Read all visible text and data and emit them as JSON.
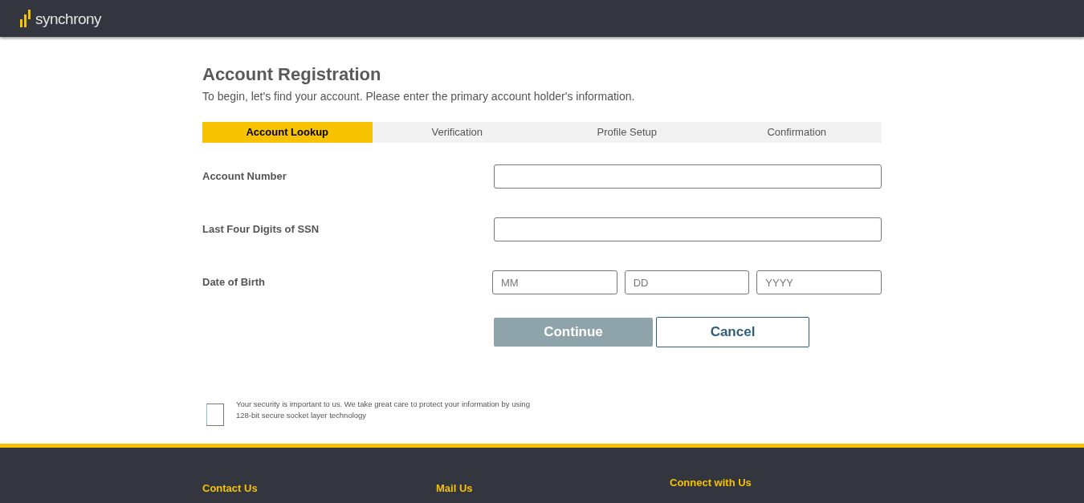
{
  "header": {
    "logo_text": "synchrony"
  },
  "page": {
    "title": "Account Registration",
    "subtitle": "To begin, let's find your account. Please enter the primary account holder's information."
  },
  "steps": [
    {
      "label": "Account Lookup",
      "selected": true
    },
    {
      "label": "Verification",
      "selected": false
    },
    {
      "label": "Profile Setup",
      "selected": false
    },
    {
      "label": "Confirmation",
      "selected": false
    }
  ],
  "fields": [
    {
      "label": "Account Number",
      "kind": "text"
    },
    {
      "label": "Last Four Digits of SSN",
      "kind": "text"
    },
    {
      "label": "Date of Birth",
      "kind": "date",
      "inputs": [
        {
          "placeholder": "MM"
        },
        {
          "placeholder": "DD"
        },
        {
          "placeholder": "YYYY"
        }
      ]
    }
  ],
  "buttons": [
    {
      "label": "Continue",
      "kind": "primary",
      "disabled": true
    },
    {
      "label": "Cancel",
      "kind": "secondary",
      "disabled": false
    }
  ],
  "security_note": "Your security is important to us. We take great care to protect your information by using 128-bit secure socket layer technology",
  "footer": {
    "headings": [
      "Contact Us",
      "Mail Us",
      "Connect with Us"
    ]
  }
}
